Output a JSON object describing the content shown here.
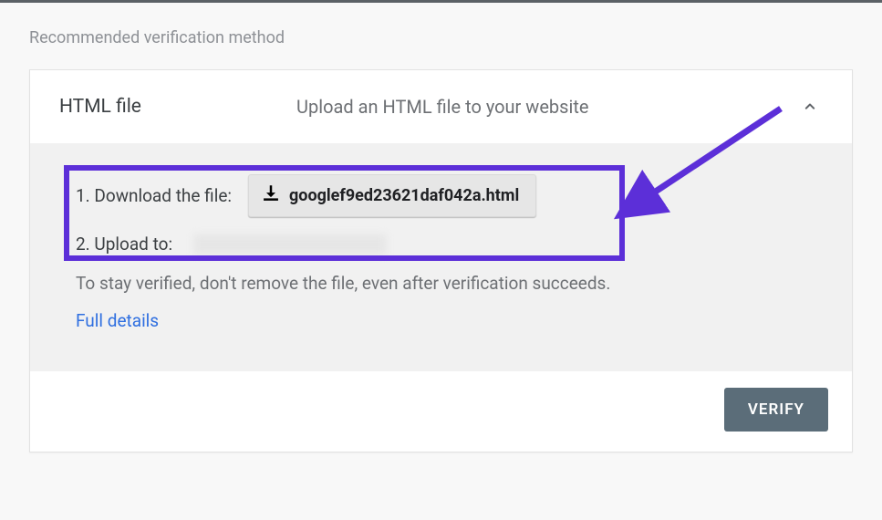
{
  "sectionHeader": "Recommended verification method",
  "card": {
    "title": "HTML file",
    "subtitle": "Upload an HTML file to your website"
  },
  "steps": {
    "downloadLabel": "1. Download the file:",
    "downloadFileName": "googlef9ed23621daf042a.html",
    "uploadLabel": "2. Upload to:"
  },
  "note": "To stay verified, don't remove the file, even after verification succeeds.",
  "detailsLink": "Full details",
  "verifyButton": "VERIFY"
}
